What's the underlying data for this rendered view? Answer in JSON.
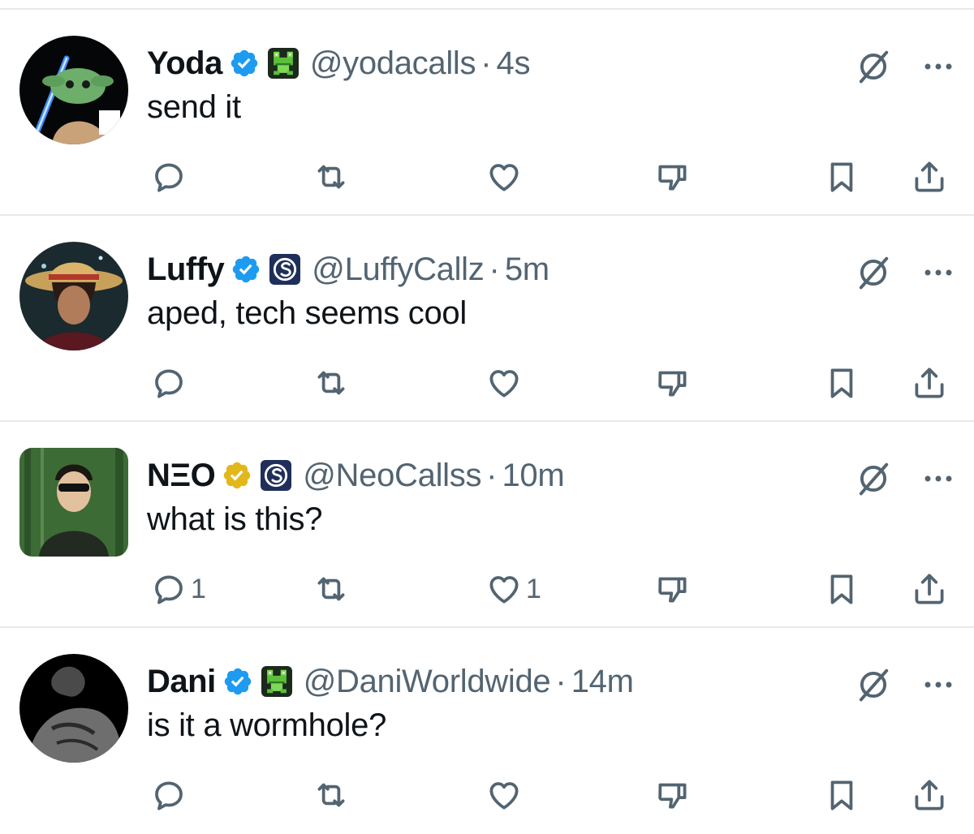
{
  "colors": {
    "text": "#0f1419",
    "muted": "#536471",
    "verified_blue": "#1d9bf0",
    "verified_gold": "#e2b719",
    "divider": "#e6e9ec"
  },
  "icons": {
    "grok": "grok-slash-circle-icon",
    "more": "more-dots-icon",
    "reply": "reply-bubble-icon",
    "retweet": "retweet-icon",
    "like": "heart-icon",
    "dislike": "thumbs-down-icon",
    "bookmark": "bookmark-icon",
    "share": "share-icon"
  },
  "tweets": [
    {
      "name": "Yoda",
      "verified": "blue",
      "affiliation": "frog-badge",
      "handle": "@yodacalls",
      "dot": "·",
      "time": "4s",
      "text": "send it",
      "reply_count": "",
      "like_count": ""
    },
    {
      "name": "Luffy",
      "verified": "blue",
      "affiliation": "sol-badge",
      "handle": "@LuffyCallz",
      "dot": "·",
      "time": "5m",
      "text": "aped, tech seems cool",
      "reply_count": "",
      "like_count": ""
    },
    {
      "name": "NΞO",
      "verified": "gold",
      "affiliation": "sol-badge",
      "handle": "@NeoCallss",
      "dot": "·",
      "time": "10m",
      "text": "what is this?",
      "reply_count": "1",
      "like_count": "1"
    },
    {
      "name": "Dani",
      "verified": "blue",
      "affiliation": "frog-badge",
      "handle": "@DaniWorldwide",
      "dot": "·",
      "time": "14m",
      "text": "is it a wormhole?",
      "reply_count": "",
      "like_count": ""
    }
  ]
}
